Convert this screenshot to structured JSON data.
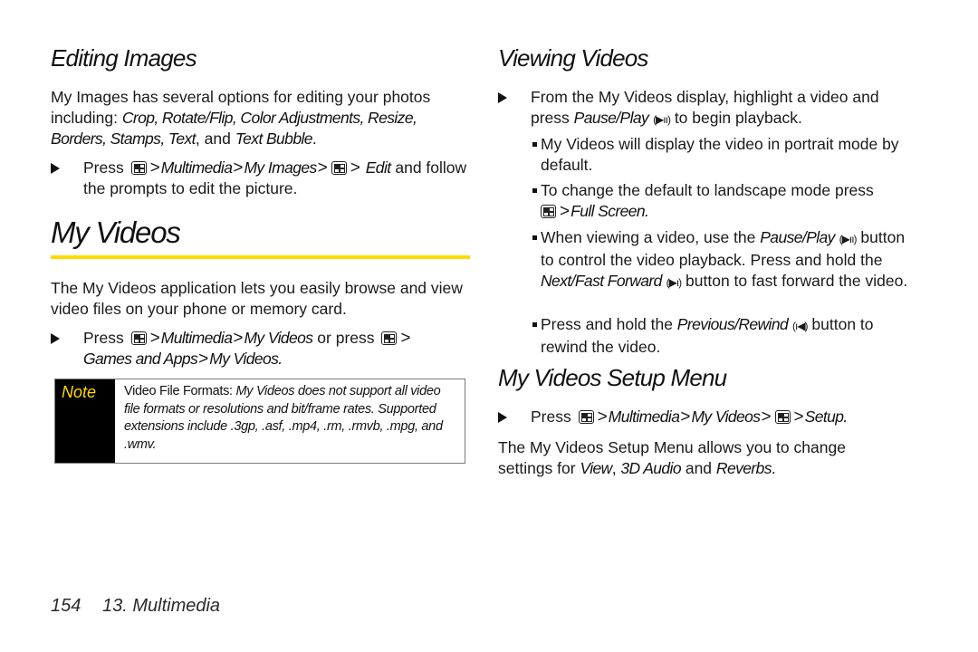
{
  "left": {
    "editing_images": {
      "title": "Editing Images",
      "intro_plain": "My Images has several options for editing your photos including: ",
      "intro_options": "Crop, Rotate/Flip, Color Adjustments, Resize, Borders, Stamps, Text",
      "intro_and": ", and ",
      "intro_last": "Text Bubble",
      "intro_end": ".",
      "step": {
        "press": "Press",
        "path1": "Multimedia",
        "path2": "My Images",
        "path3": "Edit",
        "tail": " and follow the prompts to edit the picture."
      }
    },
    "my_videos": {
      "title": "My Videos",
      "intro": "The My Videos application lets you easily browse and view video files on your phone or memory card.",
      "step": {
        "press": "Press",
        "path1": "Multimedia",
        "path2": "My Videos",
        "or_press": " or press ",
        "path3": "Games and Apps",
        "path4": "My Videos."
      },
      "note": {
        "label": "Note",
        "lead": "Video File Formats: ",
        "text": "My Videos does not support all video file formats or resolutions and bit/frame rates. Supported extensions include .3gp, .asf, .mp4, .rm, .rmvb, .mpg, and .wmv."
      }
    }
  },
  "right": {
    "viewing_videos": {
      "title": "Viewing Videos",
      "step": {
        "text1": "From the My Videos display, highlight a video and press ",
        "action": "Pause/Play",
        "glyph": "(▶ıı)",
        "text2": " to begin playback."
      },
      "bullets": [
        {
          "text": "My Videos will display the video in portrait mode by default."
        },
        {
          "text": "To change the default to landscape mode press",
          "path": "Full Screen."
        },
        {
          "t1": "When viewing a video, use the ",
          "a1": "Pause/Play",
          "g1": "(▶ıı)",
          "t2": " button to control the video playback. Press and hold the ",
          "a2": "Next/Fast Forward",
          "g2": "(▶ı)",
          "t3": " button to fast forward the video."
        },
        {
          "t1": "Press and hold the ",
          "a1": "Previous/Rewind",
          "g1": "(ı◀)",
          "t2": " button to rewind the video."
        }
      ]
    },
    "setup_menu": {
      "title": "My Videos Setup Menu",
      "step": {
        "press": "Press",
        "path1": "Multimedia",
        "path2": "My Videos",
        "path3": "Setup."
      },
      "desc1": "The My Videos Setup Menu allows you to change settings for ",
      "opt1": "View",
      "sep": ", ",
      "opt2": "3D Audio",
      "and": " and ",
      "opt3": "Reverbs",
      "end": "."
    }
  },
  "footer": {
    "page_number": "154",
    "chapter": "13. Multimedia"
  },
  "colors": {
    "accent_yellow": "#ffd900",
    "note_bg": "#000000",
    "text": "#1a1a1a"
  },
  "icons": {
    "menu_key": "menu-key-icon",
    "step_arrow": "triangle-right-icon",
    "bullet": "square-bullet-icon"
  }
}
